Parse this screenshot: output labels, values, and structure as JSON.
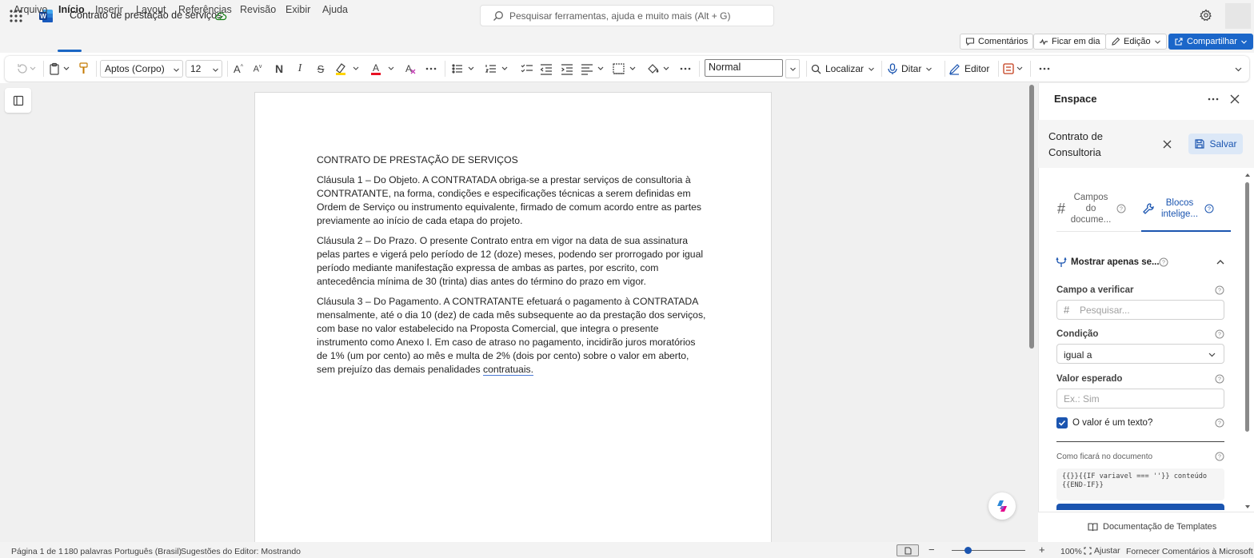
{
  "titlebar": {
    "doc_title": "Contrato de prestação de serviços",
    "search_placeholder": "Pesquisar ferramentas, ajuda e muito mais (Alt + G)"
  },
  "menu": {
    "tabs": [
      "Arquivo",
      "Início",
      "Inserir",
      "Layout",
      "Referências",
      "Revisão",
      "Exibir",
      "Ajuda"
    ],
    "active": "Início",
    "comments_label": "Comentários",
    "meeting_label": "Ficar em dia",
    "editing_label": "Edição",
    "share_label": "Compartilhar"
  },
  "ribbon": {
    "font_name": "Aptos (Corpo)",
    "font_size": "12",
    "style": "Normal",
    "find_label": "Localizar",
    "dictate_label": "Ditar",
    "editor_label": "Editor"
  },
  "document": {
    "heading": "CONTRATO DE PRESTAÇÃO DE SERVIÇOS",
    "clause1": "Cláusula 1 – Do Objeto. A CONTRATADA obriga-se a prestar serviços de consultoria à CONTRATANTE, na forma, condições e especificações técnicas a serem definidas em Ordem de Serviço ou instrumento equivalente, firmado de comum acordo entre as partes previamente ao início de cada etapa do projeto.",
    "clause2": "Cláusula 2 – Do Prazo. O presente Contrato entra em vigor na data de sua assinatura pelas partes e vigerá pelo período de 12 (doze) meses, podendo ser prorrogado por igual período mediante manifestação expressa de ambas as partes, por escrito, com antecedência mínima de 30 (trinta) dias antes do término do prazo em vigor.",
    "clause3_a": "Cláusula 3 – Do Pagamento. A CONTRATANTE efetuará o pagamento à CONTRATADA mensalmente, até o dia 10 (dez) de cada mês subsequente ao da prestação dos serviços, com base no valor estabelecido na Proposta Comercial, que integra o presente instrumento como Anexo I. Em caso de atraso no pagamento, incidirão juros moratórios de 1% (um por cento) ao mês e multa de 2% (dois por cento) sobre o valor em aberto, sem prejuízo das demais penalidades ",
    "clause3_b": "contratuais."
  },
  "pane": {
    "title": "Enspace",
    "template_name": "Contrato de Consultoria",
    "save_label": "Salvar",
    "tab_fields": "Campos do docume...",
    "tab_blocks": "Blocos intelige...",
    "section_title": "Mostrar apenas se...",
    "field_label": "Campo a verificar",
    "field_placeholder": "Pesquisar...",
    "condition_label": "Condição",
    "condition_value": "igual a",
    "expected_label": "Valor esperado",
    "expected_placeholder": "Ex.: Sim",
    "is_text_label": "O valor é um texto?",
    "is_text_checked": true,
    "preview_label": "Como ficará no documento",
    "preview_code": "{{}}{{IF variavel === ''}} conteúdo {{END-IF}}",
    "footer_link": "Documentação de Templates"
  },
  "status": {
    "page": "Página 1 de 1",
    "words": "180 palavras",
    "language": "Português (Brasil)",
    "editor": "Sugestões do Editor: Mostrando",
    "zoom": "100%",
    "fit": "Ajustar",
    "feedback": "Fornecer Comentários à Microsoft",
    "zoom_level": 1.0
  },
  "colors": {
    "accent": "#1b66c9",
    "word_blue": "#185abd"
  }
}
